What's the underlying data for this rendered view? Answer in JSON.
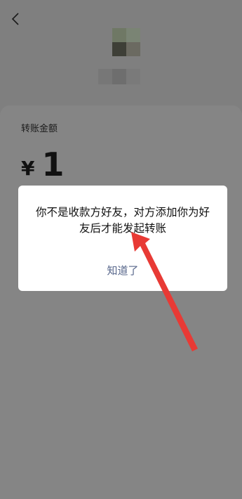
{
  "header": {
    "back_icon": "chevron-left-icon"
  },
  "recipient": {
    "avatar": "avatar-pixelated",
    "name": ""
  },
  "transfer": {
    "label": "转账金额",
    "currency": "¥",
    "amount": "1"
  },
  "dialog": {
    "message": "你不是收款方好友，对方添加你为好友后才能发起转账",
    "button_label": "知道了",
    "button_color": "#56658a"
  },
  "annotation": {
    "arrow_color": "#e83a35"
  }
}
